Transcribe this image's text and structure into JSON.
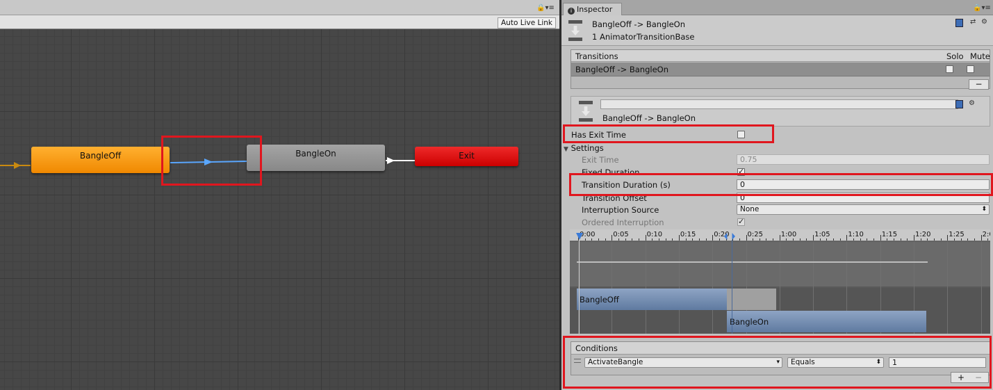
{
  "graph": {
    "toolbar": {
      "live_link_label": "Auto Live Link"
    },
    "nodes": {
      "bangle_off": "BangleOff",
      "bangle_on": "BangleOn",
      "exit": "Exit"
    }
  },
  "inspector": {
    "tab_label": "Inspector",
    "header": {
      "title": "BangleOff -> BangleOn",
      "subtitle": "1 AnimatorTransitionBase"
    },
    "transitions": {
      "title": "Transitions",
      "col_solo": "Solo",
      "col_mute": "Mute",
      "rows": [
        {
          "label": "BangleOff -> BangleOn",
          "solo": false,
          "mute": false
        }
      ]
    },
    "transition": {
      "name_value": "",
      "title": "BangleOff -> BangleOn",
      "has_exit_time_label": "Has Exit Time",
      "has_exit_time": false,
      "settings_label": "Settings",
      "exit_time_label": "Exit Time",
      "exit_time_value": "0.75",
      "fixed_duration_label": "Fixed Duration",
      "transition_duration_label": "Transition Duration (s)",
      "transition_duration_value": "0",
      "transition_offset_label": "Transition Offset",
      "transition_offset_value": "0",
      "interruption_source_label": "Interruption Source",
      "interruption_source_value": "None",
      "ordered_interruption_label": "Ordered Interruption"
    },
    "timeline": {
      "ticks": [
        "0:00",
        "0:05",
        "0:10",
        "0:15",
        "0:20",
        "0:25",
        "1:00",
        "1:05",
        "1:10",
        "1:15",
        "1:20",
        "1:25",
        "2:0"
      ],
      "clip_from": "BangleOff",
      "clip_to": "BangleOn"
    },
    "conditions": {
      "title": "Conditions",
      "parameter": "ActivateBangle",
      "mode": "Equals",
      "value": "1",
      "add_label": "+",
      "remove_label": "−"
    }
  },
  "colors": {
    "highlight": "#e0161e",
    "node_off": "#f08800",
    "node_exit": "#cc0000",
    "transition_link": "#5aa7ff",
    "clip": "#6a86ad"
  }
}
